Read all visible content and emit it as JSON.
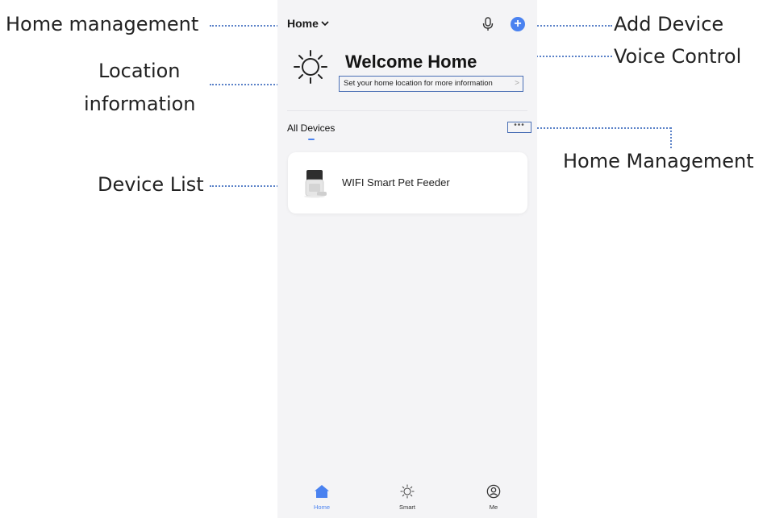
{
  "annotations": {
    "home_management_left": "Home management",
    "location_line1": "Location",
    "location_line2": "information",
    "device_list": "Device List",
    "add_device": "Add Device",
    "voice_control": "Voice Control",
    "home_management_right": "Home Management"
  },
  "header": {
    "home_label": "Home",
    "chevron_icon": "chevron-down-icon",
    "mic_icon": "microphone-icon",
    "add_icon": "plus-circle-icon",
    "add_symbol": "+"
  },
  "welcome": {
    "title": "Welcome Home",
    "location_prompt": "Set your home location for more information",
    "location_chevron": ">",
    "weather_icon": "sun-icon"
  },
  "devices": {
    "tab_label": "All Devices",
    "more_label": "•••",
    "items": [
      {
        "name": "WIFI Smart Pet Feeder",
        "icon": "pet-feeder-image"
      }
    ]
  },
  "tabbar": {
    "items": [
      {
        "label": "Home",
        "icon": "home-icon",
        "active": true
      },
      {
        "label": "Smart",
        "icon": "smart-sun-icon",
        "active": false
      },
      {
        "label": "Me",
        "icon": "profile-icon",
        "active": false
      }
    ]
  },
  "colors": {
    "accent": "#4a82f0",
    "annotation_line": "#5b82c8",
    "phone_bg": "#f4f4f6"
  }
}
